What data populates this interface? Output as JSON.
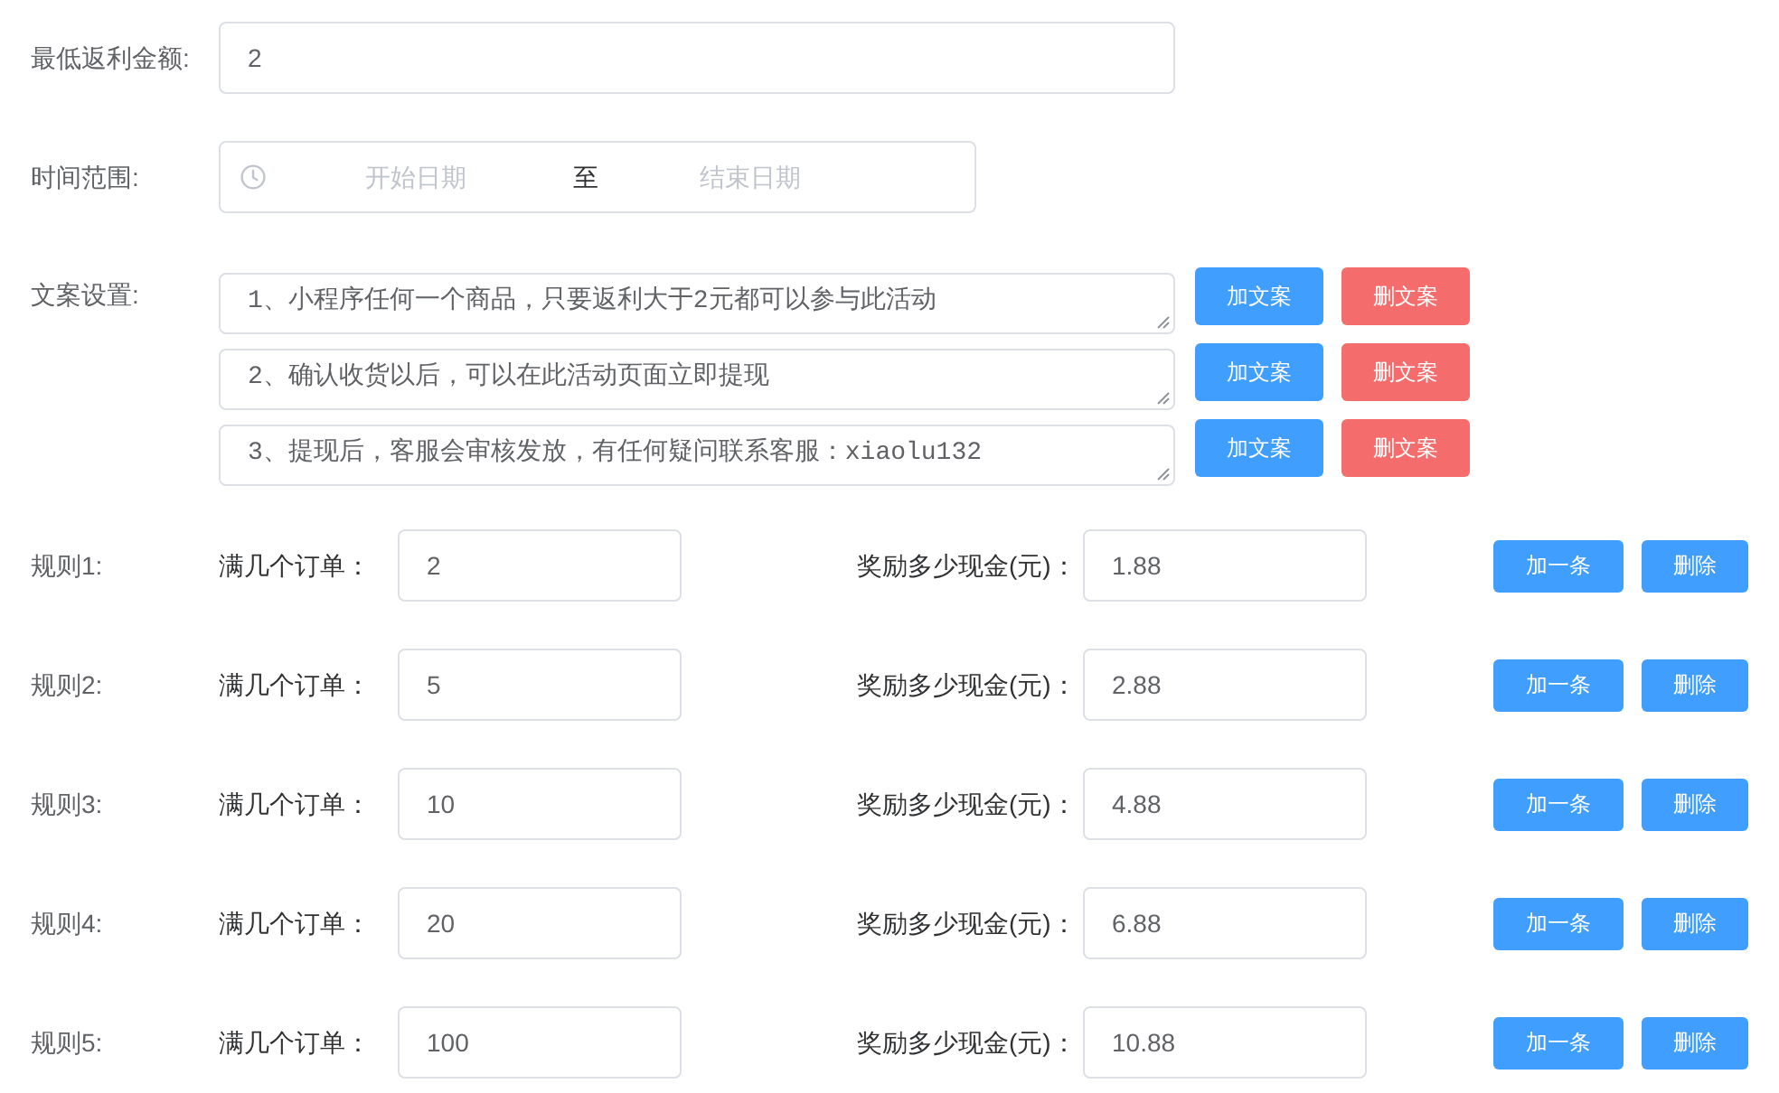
{
  "min_rebate": {
    "label": "最低返利金额:",
    "value": "2"
  },
  "time_range": {
    "label": "时间范围:",
    "start": {
      "placeholder": "开始日期"
    },
    "separator": "至",
    "end": {
      "placeholder": "结束日期"
    }
  },
  "copy_settings": {
    "label": "文案设置:",
    "items": [
      {
        "text": "1、小程序任何一个商品，只要返利大于2元都可以参与此活动",
        "add_button": "加文案",
        "delete_button": "删文案"
      },
      {
        "text": "2、确认收货以后，可以在此活动页面立即提现",
        "add_button": "加文案",
        "delete_button": "删文案"
      },
      {
        "text": "3、提现后，客服会审核发放，有任何疑问联系客服：xiaolu132",
        "add_button": "加文案",
        "delete_button": "删文案"
      }
    ]
  },
  "rules": [
    {
      "label": "规则1:",
      "orders_label": "满几个订单：",
      "orders": "2",
      "reward_label": "奖励多少现金(元)：",
      "reward": "1.88",
      "add_button": "加一条",
      "delete_button": "删除"
    },
    {
      "label": "规则2:",
      "orders_label": "满几个订单：",
      "orders": "5",
      "reward_label": "奖励多少现金(元)：",
      "reward": "2.88",
      "add_button": "加一条",
      "delete_button": "删除"
    },
    {
      "label": "规则3:",
      "orders_label": "满几个订单：",
      "orders": "10",
      "reward_label": "奖励多少现金(元)：",
      "reward": "4.88",
      "add_button": "加一条",
      "delete_button": "删除"
    },
    {
      "label": "规则4:",
      "orders_label": "满几个订单：",
      "orders": "20",
      "reward_label": "奖励多少现金(元)：",
      "reward": "6.88",
      "add_button": "加一条",
      "delete_button": "删除"
    },
    {
      "label": "规则5:",
      "orders_label": "满几个订单：",
      "orders": "100",
      "reward_label": "奖励多少现金(元)：",
      "reward": "10.88",
      "add_button": "加一条",
      "delete_button": "删除"
    }
  ]
}
